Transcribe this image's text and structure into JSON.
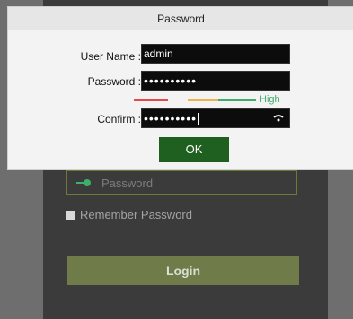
{
  "dialog": {
    "title": "Password",
    "username_label": "User Name :",
    "username_value": "admin",
    "password_label": "Password :",
    "password_value": "••••••••••",
    "strength_label": "High",
    "strength_colors": [
      "#e84a4a",
      "#f0b24a",
      "#3fae6b"
    ],
    "confirm_label": "Confirm :",
    "confirm_value": "••••••••••",
    "ok_label": "OK"
  },
  "login": {
    "password_placeholder": "Password",
    "remember_label": "Remember Password",
    "login_label": "Login"
  },
  "icons": [
    "key-icon",
    "wifi-icon"
  ]
}
